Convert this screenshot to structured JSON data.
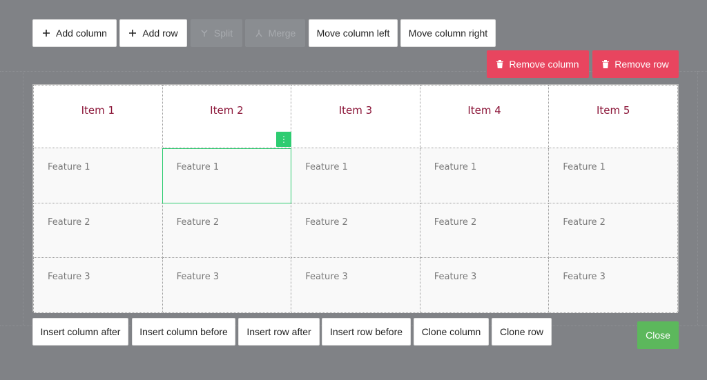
{
  "toolbar_top": {
    "add_column": "Add column",
    "add_row": "Add row",
    "split": "Split",
    "merge": "Merge",
    "move_column_left": "Move column left",
    "move_column_right": "Move column right",
    "remove_column": "Remove column",
    "remove_row": "Remove row"
  },
  "table": {
    "headers": [
      "Item 1",
      "Item 2",
      "Item 3",
      "Item 4",
      "Item 5"
    ],
    "rows": [
      [
        "Feature 1",
        "Feature 1",
        "Feature 1",
        "Feature 1",
        "Feature 1"
      ],
      [
        "Feature 2",
        "Feature 2",
        "Feature 2",
        "Feature 2",
        "Feature 2"
      ],
      [
        "Feature 3",
        "Feature 3",
        "Feature 3",
        "Feature 3",
        "Feature 3"
      ]
    ],
    "selected_cell": "row 1, column 2",
    "cell_menu_icon": "⋮"
  },
  "toolbar_bottom": {
    "insert_column_after": "Insert column after",
    "insert_column_before": "Insert column before",
    "insert_row_after": "Insert row after",
    "insert_row_before": "Insert row before",
    "clone_column": "Clone column",
    "clone_row": "Clone row",
    "close": "Close"
  },
  "colors": {
    "overlay": "#808286",
    "header_text": "#8b1538",
    "danger": "#e8455f",
    "success": "#5cb85c",
    "selection": "#2ecc71"
  }
}
